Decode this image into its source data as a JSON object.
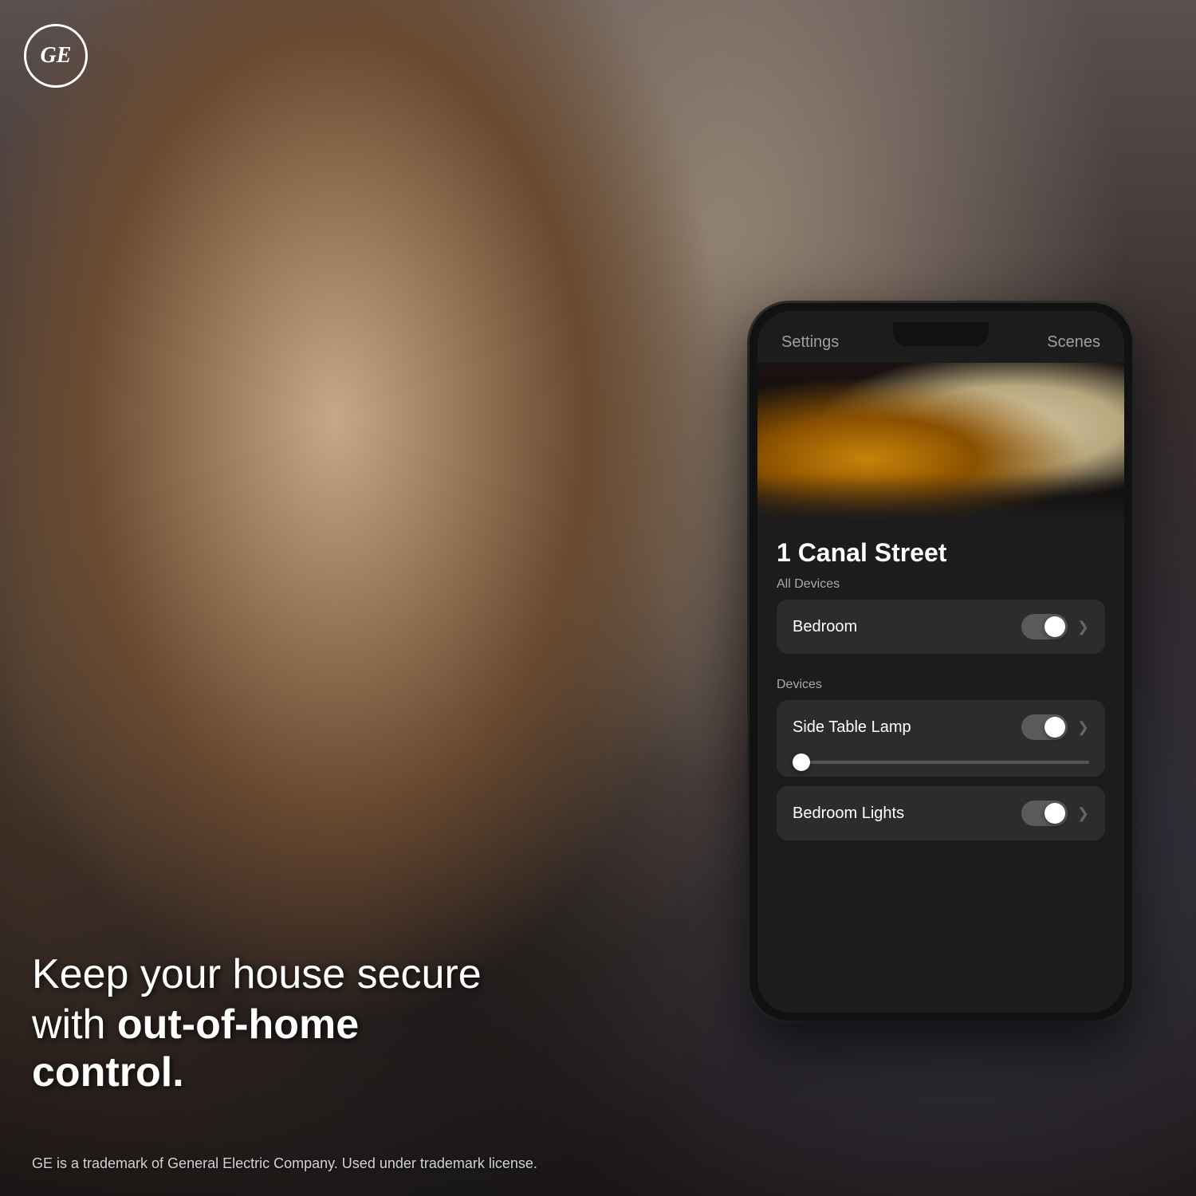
{
  "background": {
    "alt": "Woman in car looking at phone"
  },
  "logo": {
    "text": "GE",
    "alt": "GE Logo"
  },
  "tagline": {
    "line1": "Keep your house secure",
    "line2_normal": "with ",
    "line2_bold": "out-of-home control."
  },
  "disclaimer": "GE is a trademark of General Electric Company. Used under trademark license.",
  "phone": {
    "header": {
      "settings_label": "Settings",
      "scenes_label": "Scenes"
    },
    "location": {
      "title": "1 Canal Street",
      "all_devices_label": "All Devices",
      "devices_label": "Devices"
    },
    "controls": {
      "bedroom": {
        "label": "Bedroom",
        "toggle_on": true
      },
      "side_table_lamp": {
        "label": "Side Table Lamp",
        "toggle_on": true
      },
      "bedroom_lights": {
        "label": "Bedroom Lights",
        "toggle_on": true
      }
    },
    "chevron": "❯"
  }
}
